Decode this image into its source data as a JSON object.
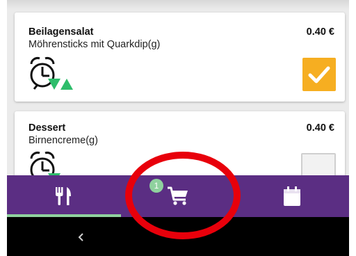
{
  "items": [
    {
      "title": "Beilagensalat",
      "description": "Möhrensticks mit Quarkdip(g)",
      "price": "0.40 €",
      "checked": true
    },
    {
      "title": "Dessert",
      "description": "Birnencreme(g)",
      "price": "0.40 €",
      "checked": false
    }
  ],
  "bottom_nav": {
    "items": [
      {
        "icon": "fork-knife-icon",
        "active": true
      },
      {
        "icon": "cart-icon",
        "active": false
      },
      {
        "icon": "calendar-icon",
        "active": false
      }
    ],
    "cart_badge": "1"
  },
  "system_nav": {
    "icons": [
      "back-icon",
      "home-icon"
    ]
  },
  "colors": {
    "nav_background": "#5b2e83",
    "accent_green": "#8fd19e",
    "checkbox_orange": "#f6ae21",
    "annotation_red": "#e8000b"
  }
}
